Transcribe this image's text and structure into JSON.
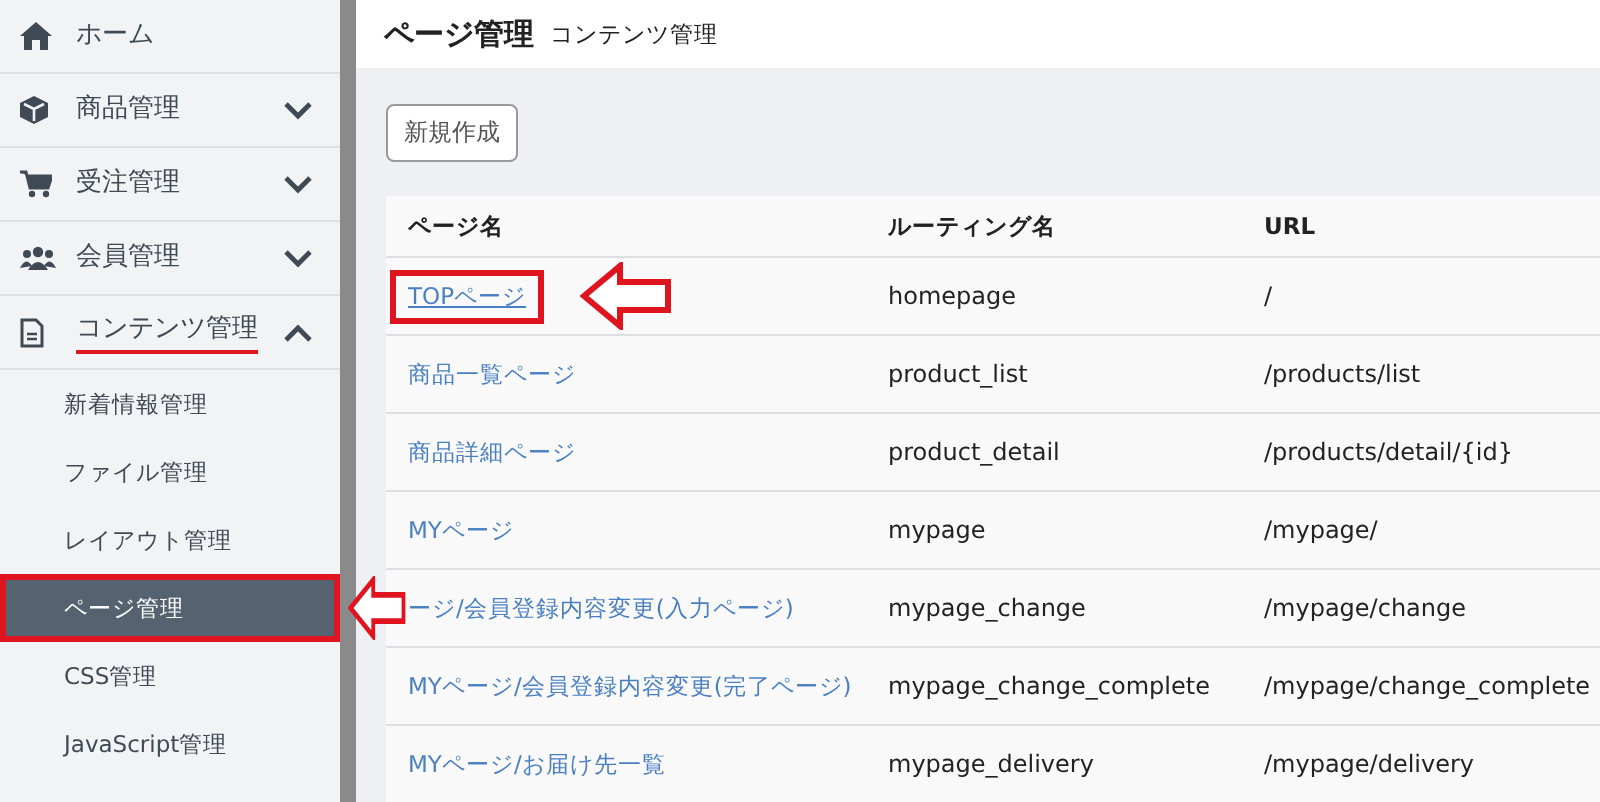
{
  "sidebar": {
    "items": [
      {
        "label": "ホーム",
        "underlined": false
      },
      {
        "label": "商品管理",
        "expanded": false,
        "underlined": false
      },
      {
        "label": "受注管理",
        "expanded": false,
        "underlined": false
      },
      {
        "label": "会員管理",
        "expanded": false,
        "underlined": false
      },
      {
        "label": "コンテンツ管理",
        "expanded": true,
        "underlined": true,
        "children": [
          {
            "label": "新着情報管理",
            "selected": false,
            "highlighted": false
          },
          {
            "label": "ファイル管理",
            "selected": false,
            "highlighted": false
          },
          {
            "label": "レイアウト管理",
            "selected": false,
            "highlighted": false
          },
          {
            "label": "ページ管理",
            "selected": true,
            "highlighted": true
          },
          {
            "label": "CSS管理",
            "selected": false,
            "highlighted": false
          },
          {
            "label": "JavaScript管理",
            "selected": false,
            "highlighted": false
          }
        ]
      }
    ]
  },
  "header": {
    "title": "ページ管理",
    "subtitle": "コンテンツ管理"
  },
  "new_button": "新規作成",
  "table": {
    "columns": [
      "ページ名",
      "ルーティング名",
      "URL"
    ],
    "rows": [
      {
        "name": "TOPページ",
        "routing": "homepage",
        "url": "/",
        "highlighted": true
      },
      {
        "name": "商品一覧ページ",
        "routing": "product_list",
        "url": "/products/list",
        "highlighted": false
      },
      {
        "name": "商品詳細ページ",
        "routing": "product_detail",
        "url": "/products/detail/{id}",
        "highlighted": false
      },
      {
        "name": "MYページ",
        "routing": "mypage",
        "url": "/mypage/",
        "highlighted": false
      },
      {
        "name": "ージ/会員登録内容変更(入力ページ)",
        "routing": "mypage_change",
        "url": "/mypage/change",
        "highlighted": false
      },
      {
        "name": "MYページ/会員登録内容変更(完了ページ)",
        "routing": "mypage_change_complete",
        "url": "/mypage/change_complete",
        "highlighted": false
      },
      {
        "name": "MYページ/お届け先一覧",
        "routing": "mypage_delivery",
        "url": "/mypage/delivery",
        "highlighted": false
      }
    ]
  }
}
